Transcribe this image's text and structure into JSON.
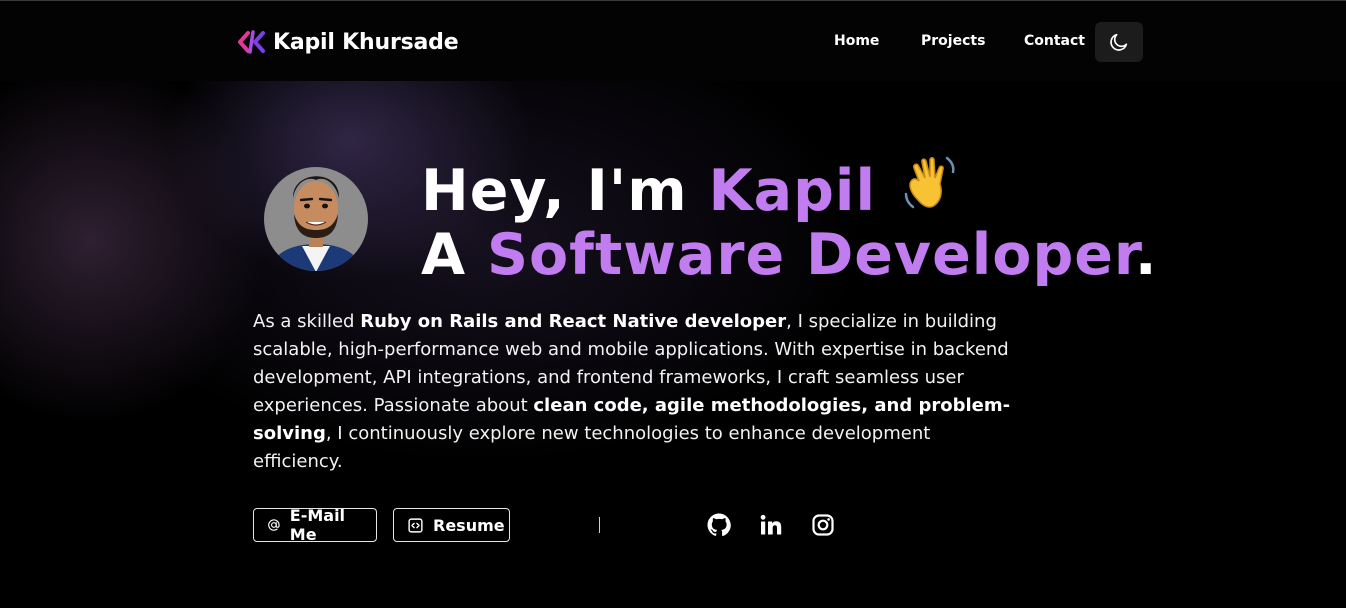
{
  "header": {
    "brand_name": "Kapil Khursade",
    "nav": {
      "home": "Home",
      "projects": "Projects",
      "contact": "Contact"
    },
    "theme_toggle_icon": "moon-icon"
  },
  "hero": {
    "greeting_prefix": "Hey, I'm ",
    "name": "Kapil",
    "wave_icon": "waving-hand-icon",
    "role_prefix": "A ",
    "role": "Software Developer",
    "role_suffix": "."
  },
  "intro": {
    "t1": "As a skilled ",
    "b1": "Ruby on Rails and React Native developer",
    "t2": ", I specialize in building scalable, high-performance web and mobile applications. With expertise in backend development, API integrations, and frontend frameworks, I craft seamless user experiences. Passionate about ",
    "b2": "clean code, agile methodologies, and problem-solving",
    "t3": ", I continuously explore new technologies to enhance development efficiency."
  },
  "actions": {
    "email_label": "E-Mail Me",
    "resume_label": "Resume"
  },
  "social": [
    "github-icon",
    "linkedin-icon",
    "instagram-icon"
  ],
  "colors": {
    "accent": "#c17cf0",
    "logo_pink": "#e0379a",
    "logo_purple": "#7b3fe4",
    "background": "#000000"
  }
}
